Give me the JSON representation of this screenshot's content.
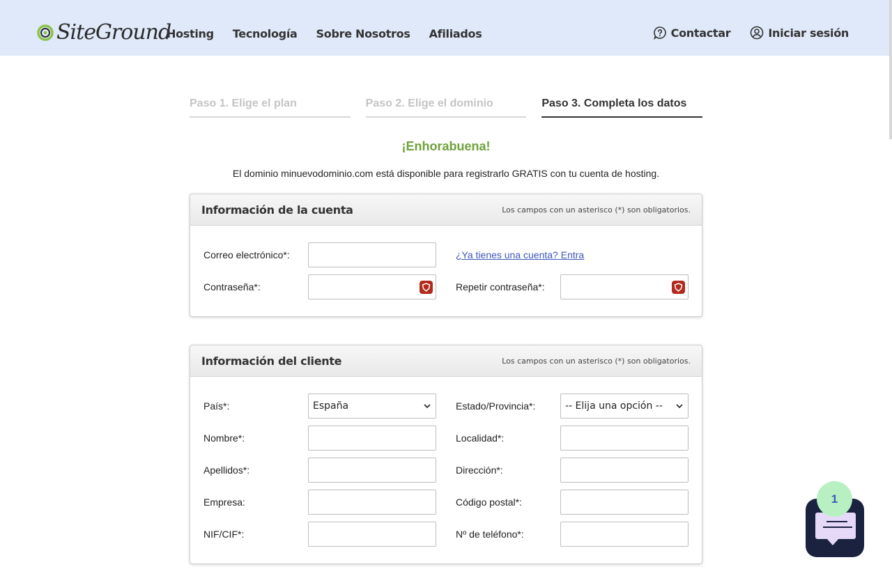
{
  "header": {
    "logo": "SiteGround",
    "nav": [
      "Hosting",
      "Tecnología",
      "Sobre Nosotros",
      "Afiliados"
    ],
    "contact_label": "Contactar",
    "login_label": "Iniciar sesión"
  },
  "steps": [
    {
      "label": "Paso 1. Elige el plan",
      "active": false
    },
    {
      "label": "Paso 2. Elige el dominio",
      "active": false
    },
    {
      "label": "Paso 3. Completa los datos",
      "active": true
    }
  ],
  "congrats": "¡Enhorabuena!",
  "subtext": "El dominio minuevodominio.com está disponible para registrarlo GRATIS con tu cuenta de hosting.",
  "account": {
    "title": "Información de la cuenta",
    "note": "Los campos con un asterisco (*) son obligatorios.",
    "email_label": "Correo electrónico*:",
    "email_value": "",
    "have_account_link": "¿Ya tienes una cuenta? Entra",
    "password_label": "Contraseña*:",
    "repeat_password_label": "Repetir contraseña*:"
  },
  "client": {
    "title": "Información del cliente",
    "note": "Los campos con un asterisco (*) son obligatorios.",
    "country_label": "País*:",
    "country_value": "España",
    "state_label": "Estado/Provincia*:",
    "state_value": "-- Elija una opción --",
    "name_label": "Nombre*:",
    "city_label": "Localidad*:",
    "surname_label": "Apellidos*:",
    "address_label": "Dirección*:",
    "company_label": "Empresa:",
    "postal_label": "Código postal*:",
    "nif_label": "NIF/CIF*:",
    "phone_label": "Nº de teléfono*:"
  },
  "chat": {
    "badge_count": "1"
  },
  "colors": {
    "header_bg": "#dfe9f9",
    "success_green": "#6ea03a",
    "link_blue": "#3e57b9",
    "chat_bg": "#1a2240"
  },
  "icons": [
    "siteground-logo-icon",
    "help-circle-icon",
    "user-circle-icon",
    "password-manager-icon",
    "chevron-down-icon",
    "chat-icon"
  ]
}
